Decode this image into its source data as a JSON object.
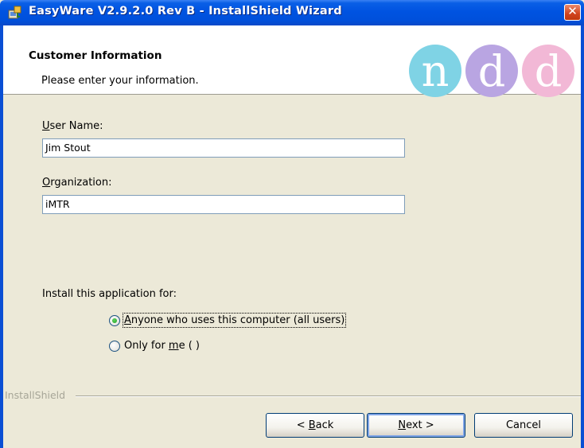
{
  "window": {
    "title": "EasyWare V2.9.2.0 Rev B - InstallShield Wizard"
  },
  "banner": {
    "title": "Customer Information",
    "subtitle": "Please enter your information.",
    "logo_letters": [
      "n",
      "d",
      "d"
    ],
    "logo_colors": [
      "#7FD3E5",
      "#B9A5E2",
      "#F2B8D6"
    ]
  },
  "form": {
    "user_name_label_pre": "",
    "user_name_label_u": "U",
    "user_name_label_post": "ser Name:",
    "user_name_value": "Jim Stout",
    "org_label_u": "O",
    "org_label_post": "rganization:",
    "org_value": "iMTR",
    "install_for_label": "Install this application for:",
    "options": [
      {
        "u": "A",
        "post": "nyone who uses this computer (all users)",
        "selected": true
      },
      {
        "pre": "Only for ",
        "u": "m",
        "post": "e ( )",
        "selected": false
      }
    ]
  },
  "footer": {
    "brand": "InstallShield",
    "back": {
      "pre": "< ",
      "u": "B",
      "post": "ack"
    },
    "next": {
      "u": "N",
      "post": "ext >"
    },
    "cancel": "Cancel"
  },
  "colors": {
    "titlebar": "#0053E1",
    "dialog_bg": "#ECE9D8",
    "radio_selected": "#21A121"
  }
}
